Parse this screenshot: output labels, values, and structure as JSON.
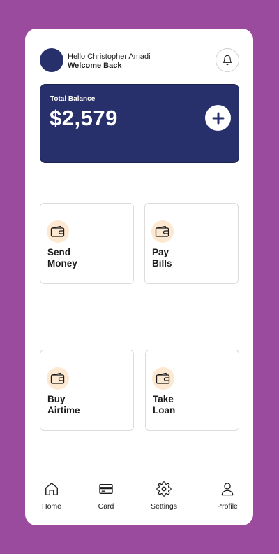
{
  "header": {
    "greeting": "Hello Christopher Amadi",
    "subtitle": "Welcome Back",
    "notification_icon": "bell-icon"
  },
  "balance": {
    "label": "Total Balance",
    "amount": "$2,579",
    "add_icon": "plus-icon"
  },
  "actions": [
    {
      "label_line1": "Send",
      "label_line2": "Money",
      "icon": "wallet-icon"
    },
    {
      "label_line1": "Pay",
      "label_line2": "Bills",
      "icon": "wallet-icon"
    },
    {
      "label_line1": "Buy",
      "label_line2": "Airtime",
      "icon": "wallet-icon"
    },
    {
      "label_line1": "Take",
      "label_line2": "Loan",
      "icon": "wallet-icon"
    }
  ],
  "nav": {
    "items": [
      {
        "label": "Home",
        "icon": "home-icon"
      },
      {
        "label": "Card",
        "icon": "card-icon"
      },
      {
        "label": "Settings",
        "icon": "gear-icon"
      },
      {
        "label": "Profile",
        "icon": "user-icon"
      }
    ]
  },
  "colors": {
    "background": "#9a4b9e",
    "card": "#27306b",
    "icon_bg": "#fde8d2",
    "surface": "#ffffff"
  }
}
